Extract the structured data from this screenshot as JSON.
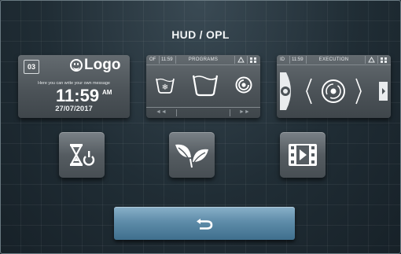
{
  "screen": {
    "title": "HUD / OPL"
  },
  "panels": {
    "hud": {
      "badge": "03",
      "logo_text": "Logo",
      "message": "Here you can write your own message",
      "time": "11:59",
      "ampm": "AM",
      "date": "27/07/2017"
    },
    "programs": {
      "id": "OF",
      "time": "11:59",
      "title": "PROGRAMS",
      "prev": "◄◄",
      "next": "►►"
    },
    "execution": {
      "id": "ID",
      "time": "11:59",
      "title": "EXECUTION"
    }
  },
  "buttons": {
    "timer": {
      "icon": "hourglass-power-icon"
    },
    "eco": {
      "icon": "leaves-icon"
    },
    "video": {
      "icon": "film-play-icon"
    },
    "back": {
      "icon": "return-arrow-icon"
    }
  },
  "colors": {
    "background": "#1d2a32",
    "panel": "#4b5257",
    "back_button": "#5e8ca9"
  }
}
